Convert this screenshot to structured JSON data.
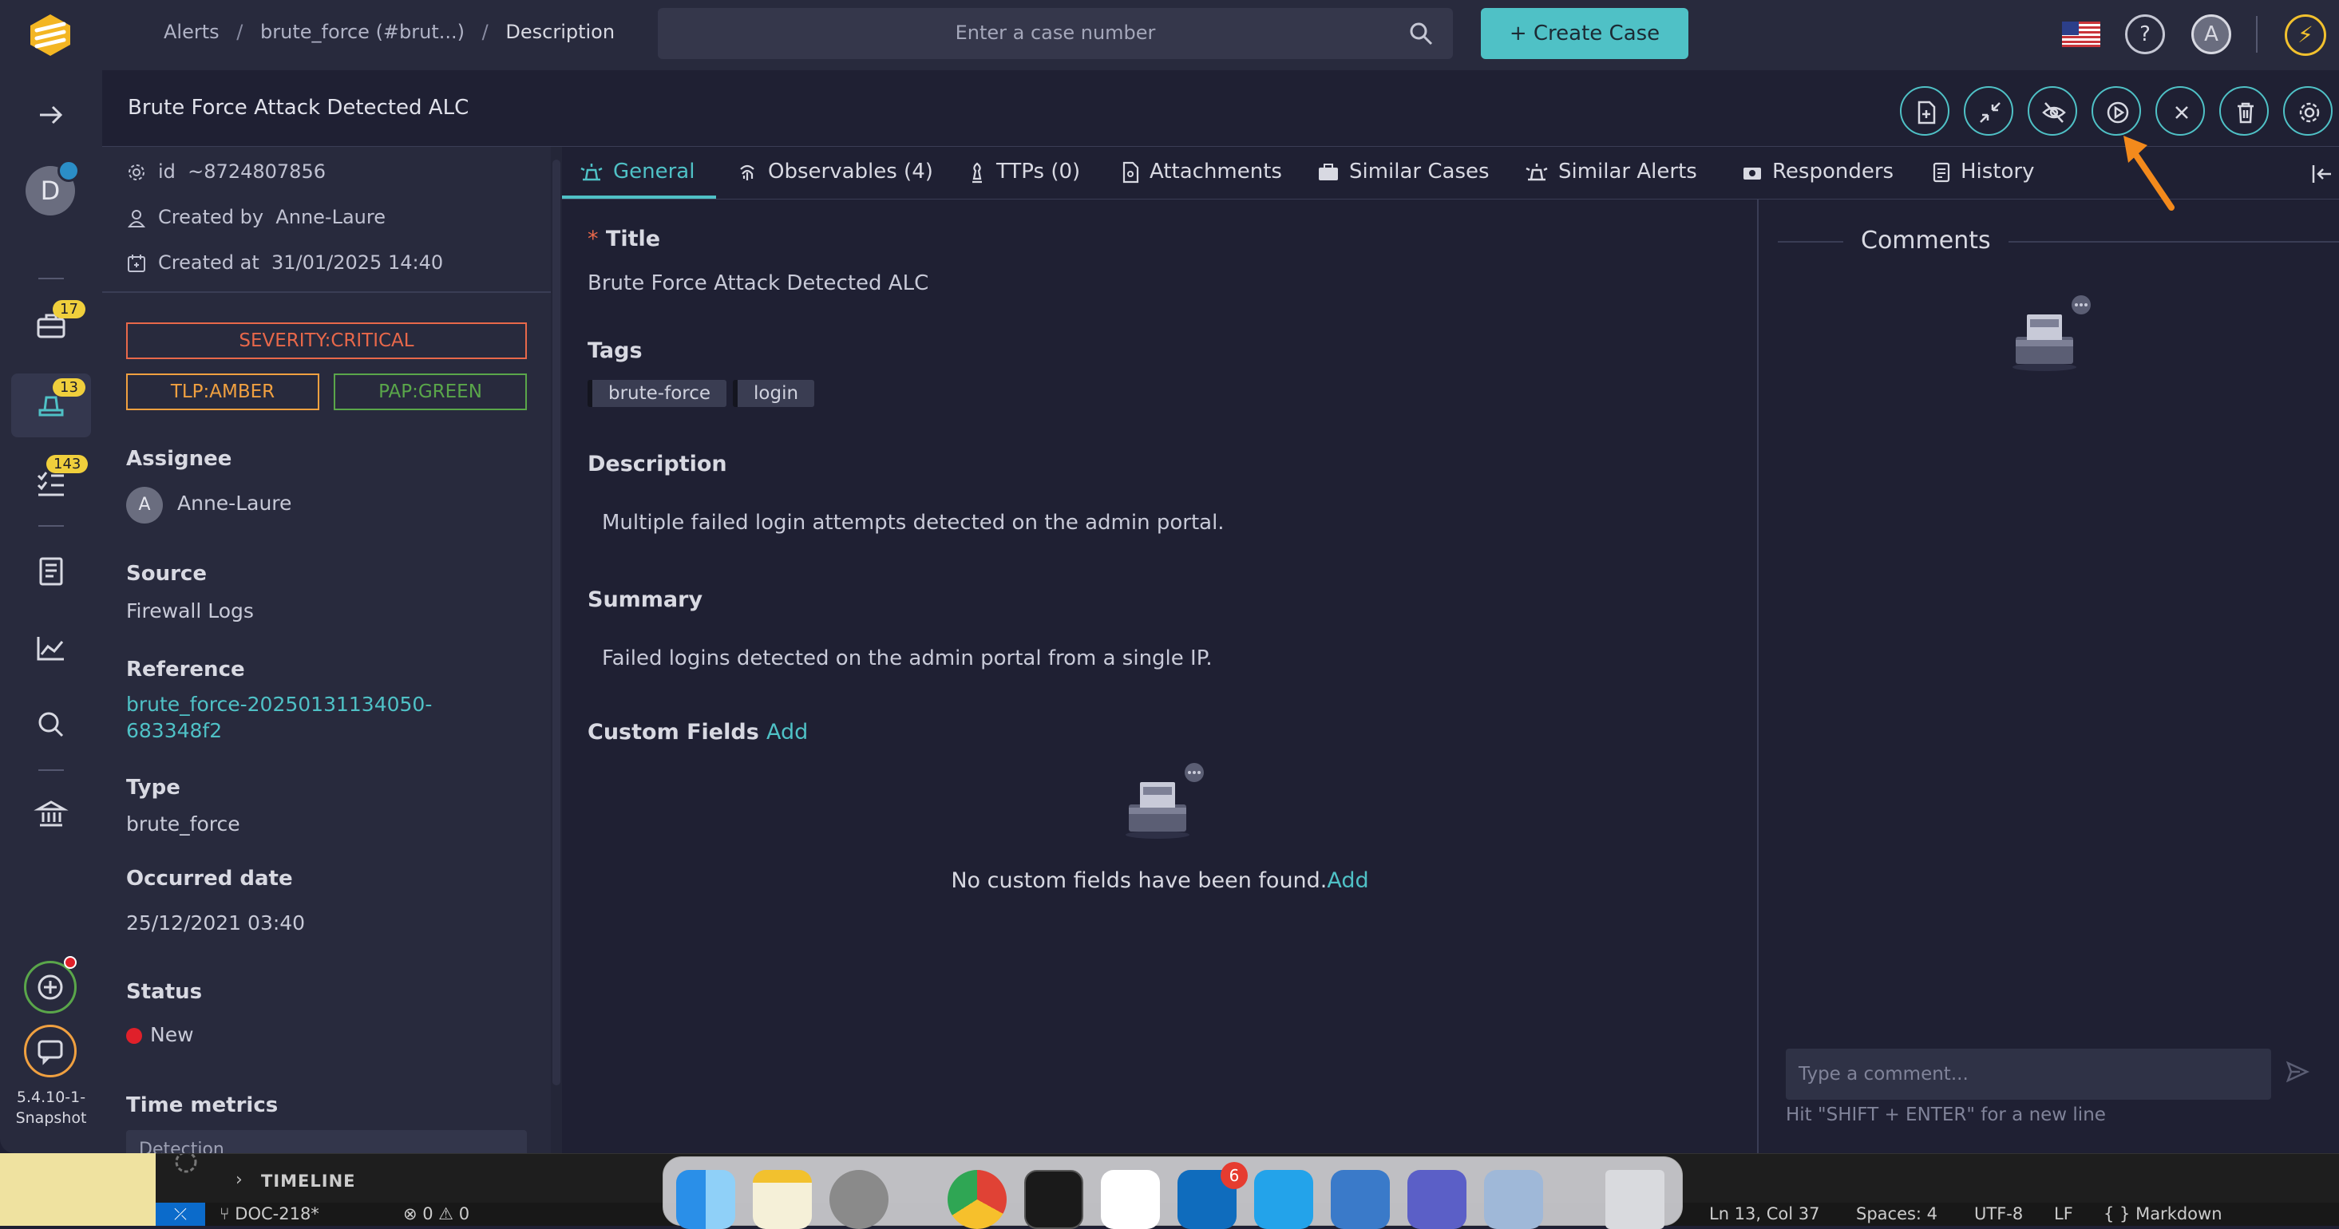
{
  "topbar": {
    "breadcrumb": [
      "Alerts",
      "brute_force (#brut...)",
      "Description"
    ],
    "search_placeholder": "Enter a case number",
    "create_case": "+ Create Case",
    "help_icon": "?",
    "user_initial": "A",
    "bolt_icon": "⚡"
  },
  "nav": {
    "avatar_initial": "D",
    "badges": {
      "cases": "17",
      "alerts": "13",
      "tasks": "143"
    },
    "version_line1": "5.4.10-1-",
    "version_line2": "Snapshot"
  },
  "alert": {
    "title": "Brute Force Attack Detected ALC",
    "id_label": "id",
    "id_value": "~8724807856",
    "created_by_label": "Created by",
    "created_by": "Anne-Laure",
    "created_at_label": "Created at",
    "created_at": "31/01/2025 14:40",
    "severity": "SEVERITY:CRITICAL",
    "tlp": "TLP:AMBER",
    "pap": "PAP:GREEN",
    "assignee_label": "Assignee",
    "assignee_initial": "A",
    "assignee": "Anne-Laure",
    "source_label": "Source",
    "source": "Firewall Logs",
    "reference_label": "Reference",
    "reference_line1": "brute_force-20250131134050-",
    "reference_line2": "683348f2",
    "type_label": "Type",
    "type": "brute_force",
    "occurred_label": "Occurred date",
    "occurred": "25/12/2021 03:40",
    "status_label": "Status",
    "status": "New",
    "time_metrics_label": "Time metrics",
    "detection_label": "Detection"
  },
  "tabs": [
    {
      "label": "General"
    },
    {
      "label": "Observables (4)"
    },
    {
      "label": "TTPs (0)"
    },
    {
      "label": "Attachments"
    },
    {
      "label": "Similar Cases"
    },
    {
      "label": "Similar Alerts"
    },
    {
      "label": "Responders"
    },
    {
      "label": "History"
    }
  ],
  "general": {
    "title_required": "*",
    "title_label": "Title",
    "title_value": "Brute Force Attack Detected ALC",
    "tags_label": "Tags",
    "tags": [
      "brute-force",
      "login"
    ],
    "description_label": "Description",
    "description": "Multiple failed login attempts detected on the admin portal.",
    "summary_label": "Summary",
    "summary": "Failed logins detected on the admin portal from a single IP.",
    "custom_fields_label": "Custom Fields",
    "custom_fields_add": "Add",
    "custom_fields_empty": "No custom fields have been found.",
    "custom_fields_empty_add": "Add"
  },
  "comments": {
    "title": "Comments",
    "placeholder": "Type a comment...",
    "hint": "Hit \"SHIFT + ENTER\" for a new line"
  },
  "vscode": {
    "timeline": "TIMELINE",
    "branch": "DOC-218*",
    "problems": "⊗ 0 ⚠ 0",
    "cursor": "Ln 13, Col 37",
    "spaces": "Spaces: 4",
    "encoding": "UTF-8",
    "eol": "LF",
    "language": "{ } Markdown"
  },
  "dock": {
    "outlook_badge": "6"
  },
  "colors": {
    "accent": "#4fc1c6",
    "severity": "#e8684a",
    "amber": "#f0a040",
    "green": "#5aa64a",
    "status_new": "#e0202a"
  }
}
